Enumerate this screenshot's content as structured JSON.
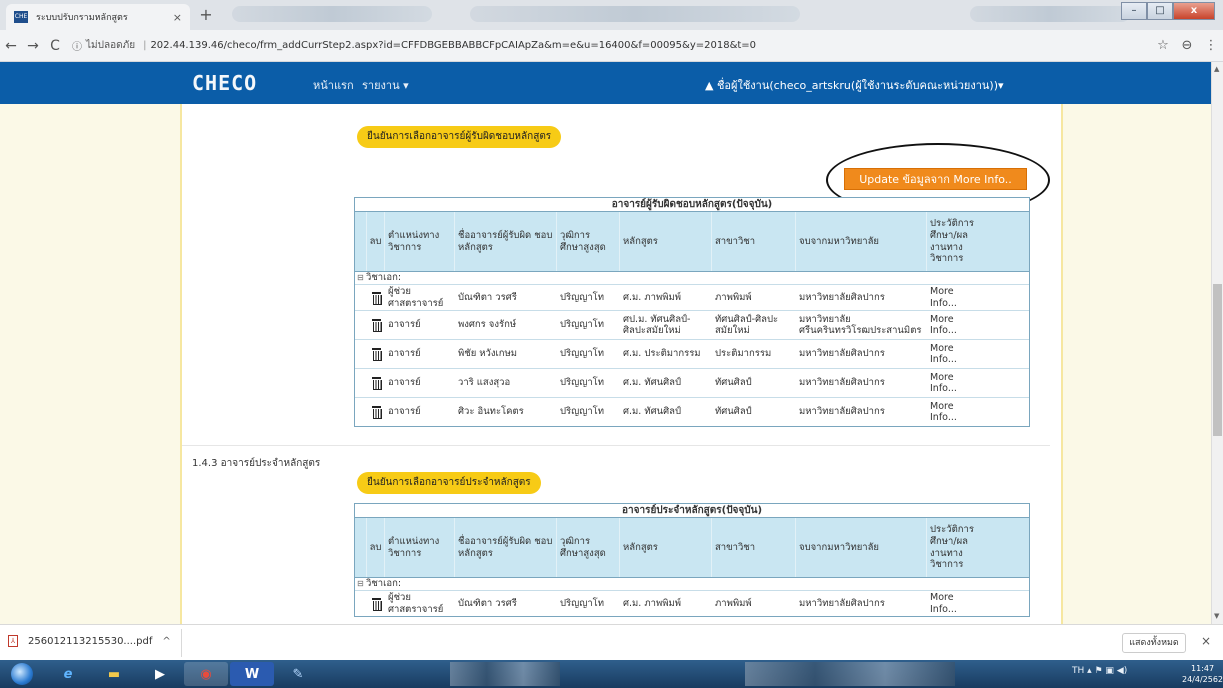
{
  "browser": {
    "tab_title": "ระบบปรับกรามหลักสูตร",
    "tab_close": "×",
    "new_tab": "+",
    "nav": {
      "back": "←",
      "forward": "→",
      "reload": "C"
    },
    "security_icon": "ⓘ",
    "security_label": "ไม่ปลอดภัย",
    "separator": "|",
    "url": "202.44.139.46/checo/frm_addCurrStep2.aspx?id=CFFDBGEBBABBCFpCAIApZa&m=e&u=16400&f=00095&y=2018&t=0",
    "star_icon": "☆",
    "account_icon": "⊖",
    "menu_icon": "⋮"
  },
  "site": {
    "logo": "CHECO",
    "nav_home": "หน้าแรก",
    "nav_reports": "รายงาน ▾",
    "user": "▲ ชื่อผู้ใช้งาน(checo_artskru(ผู้ใช้งานระดับคณะหน่วยงาน))▾"
  },
  "section1": {
    "confirm_label": "ยืนยันการเลือกอาจารย์ผู้รับผิดชอบหลักสูตร",
    "update_button": "Update ข้อมูลจาก More Info.."
  },
  "table1": {
    "title": "อาจารย์ผู้รับผิดชอบหลักสูตร(ปัจจุบัน)",
    "headers": [
      "ลบ",
      "ตำแหน่งทาง วิชาการ",
      "ชื่ออาจารย์ผู้รับผิด ชอบหลักสูตร",
      "วุฒิการ ศึกษาสูงสุด",
      "หลักสูตร",
      "สาขาวิชา",
      "จบจากมหาวิทยาลัย",
      "ประวัติการ ศึกษา/ผล งานทาง วิชาการ"
    ],
    "group_toggle": "⊟",
    "group": "วิชาเอก:",
    "rows": [
      [
        "ผู้ช่วย ศาสตราจารย์",
        "บัณฑิตา วรศรี",
        "ปริญญาโท",
        "ศ.ม. ภาพพิมพ์",
        "ภาพพิมพ์",
        "มหาวิทยาลัยศิลปากร",
        "More Info..."
      ],
      [
        "อาจารย์",
        "พงศกร จงรักษ์",
        "ปริญญาโท",
        "ศป.ม. ทัศนศิลป์-ศิลปะสมัยใหม่",
        "ทัศนศิลป์-ศิลปะ สมัยใหม่",
        "มหาวิทยาลัย ศรีนครินทรวิโรฒประสานมิตร",
        "More Info..."
      ],
      [
        "อาจารย์",
        "พิชัย หวังเกษม",
        "ปริญญาโท",
        "ศ.ม. ประติมากรรม",
        "ประติมากรรม",
        "มหาวิทยาลัยศิลปากร",
        "More Info..."
      ],
      [
        "อาจารย์",
        "วาริ แสงสุวอ",
        "ปริญญาโท",
        "ศ.ม. ทัศนศิลป์",
        "ทัศนศิลป์",
        "มหาวิทยาลัยศิลปากร",
        "More Info..."
      ],
      [
        "อาจารย์",
        "ศิวะ อินทะโคตร",
        "ปริญญาโท",
        "ศ.ม. ทัศนศิลป์",
        "ทัศนศิลป์",
        "มหาวิทยาลัยศิลปากร",
        "More Info..."
      ]
    ]
  },
  "section2": {
    "heading": "1.4.3 อาจารย์ประจำหลักสูตร",
    "confirm_label": "ยืนยันการเลือกอาจารย์ประจำหลักสูตร"
  },
  "table2": {
    "title": "อาจารย์ประจำหลักสูตร(ปัจจุบัน)",
    "headers": [
      "ลบ",
      "ตำแหน่งทาง วิชาการ",
      "ชื่ออาจารย์ผู้รับผิด ชอบหลักสูตร",
      "วุฒิการ ศึกษาสูงสุด",
      "หลักสูตร",
      "สาขาวิชา",
      "จบจากมหาวิทยาลัย",
      "ประวัติการ ศึกษา/ผล งานทาง วิชาการ"
    ],
    "group_toggle": "⊟",
    "group": "วิชาเอก:",
    "rows": [
      [
        "ผู้ช่วย ศาสตราจารย์",
        "บัณฑิตา วรศรี",
        "ปริญญาโท",
        "ศ.ม. ภาพพิมพ์",
        "ภาพพิมพ์",
        "มหาวิทยาลัยศิลปากร",
        "More Info..."
      ]
    ]
  },
  "downloads": {
    "file": "256012113215530....pdf",
    "caret": "^",
    "show_all": "แสดงทั้งหมด",
    "close": "×"
  },
  "taskbar": {
    "tray": "TH  ▴  ⚑  ▣  ◀)",
    "time": "11:47",
    "date": "24/4/2562"
  }
}
